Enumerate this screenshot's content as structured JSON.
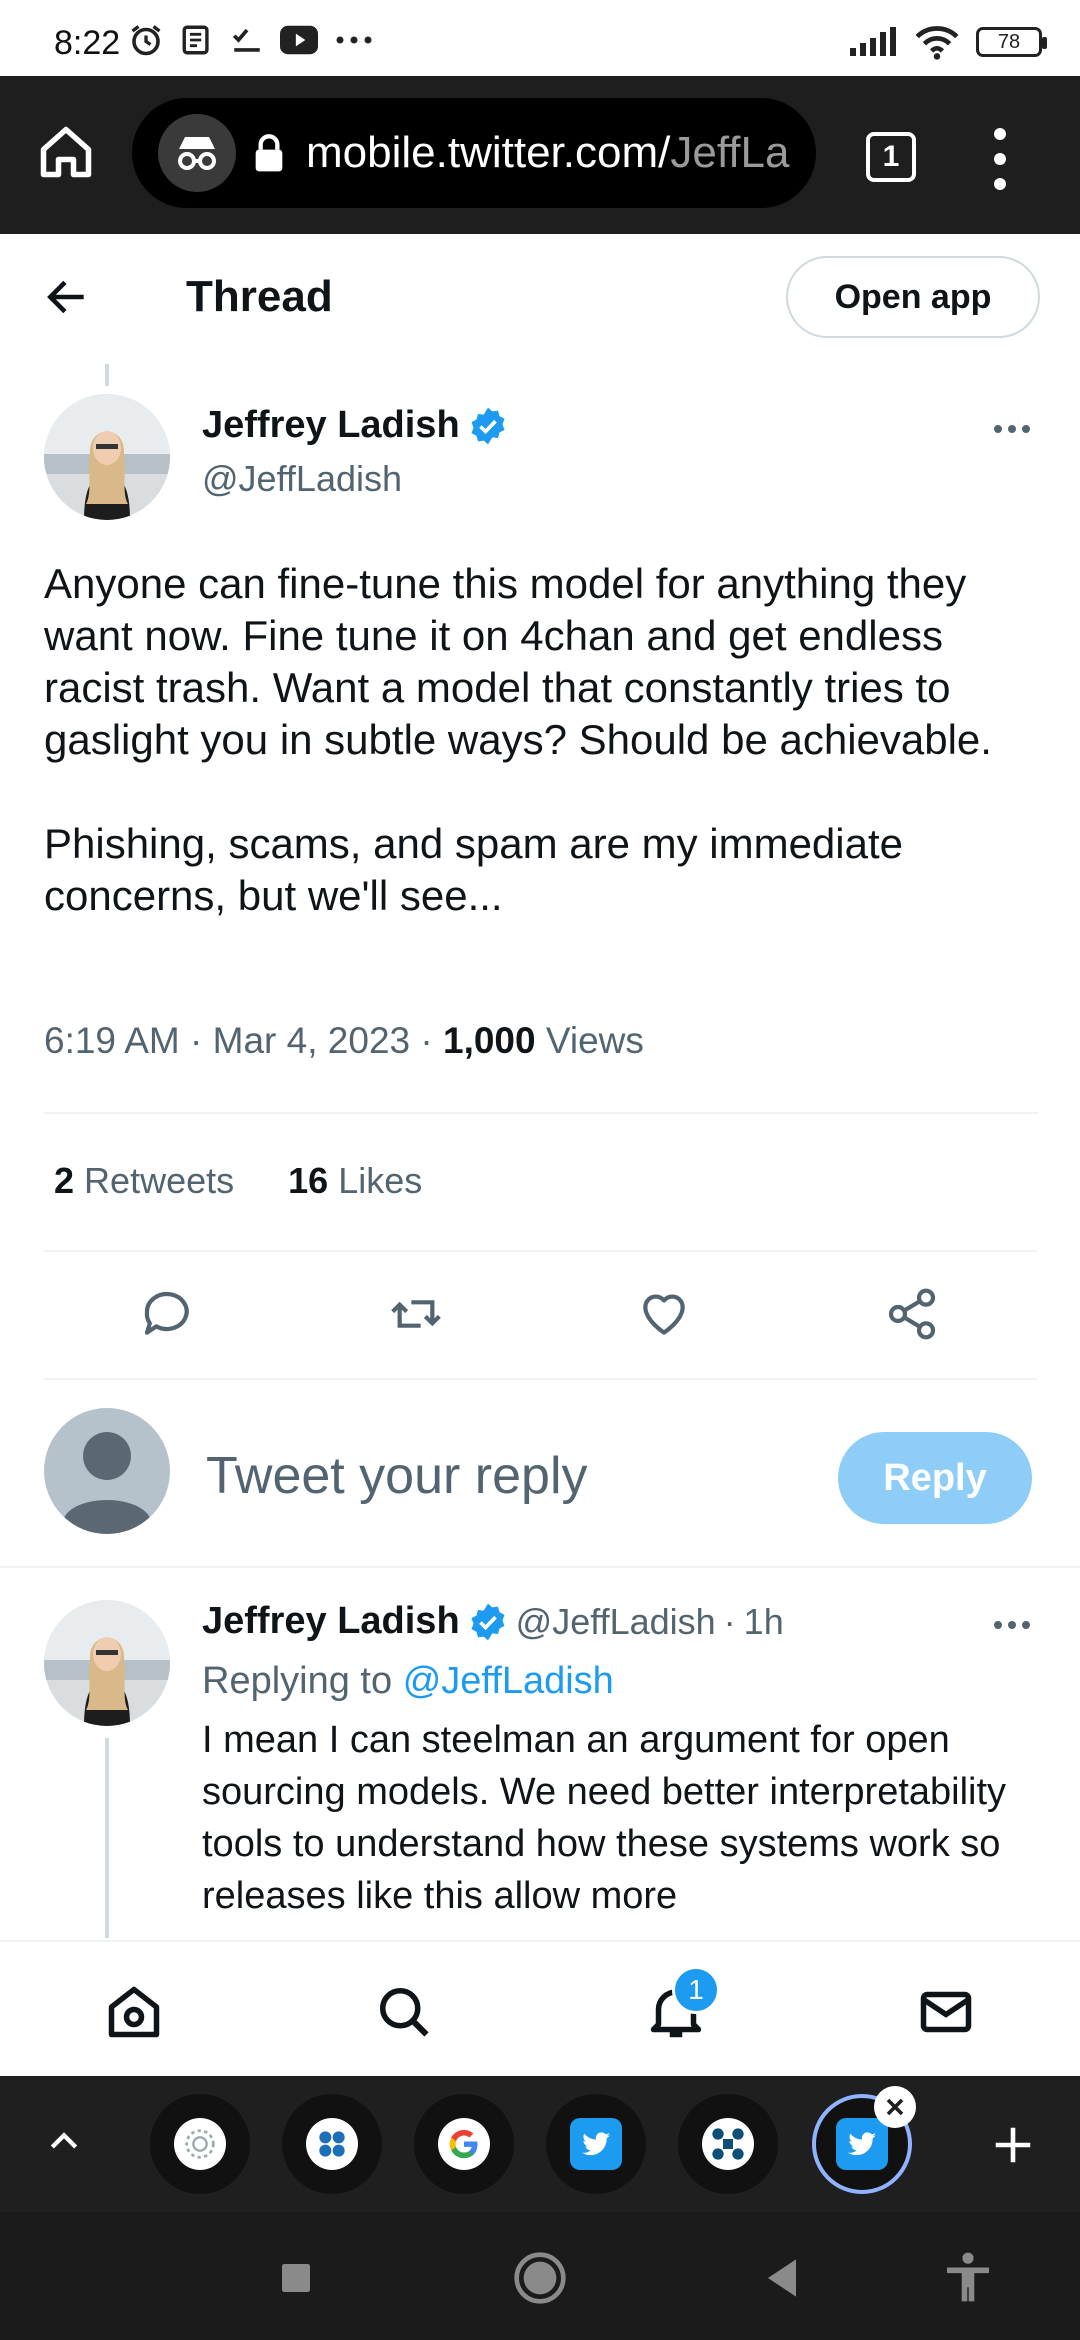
{
  "status_bar": {
    "time": "8:22",
    "battery": "78"
  },
  "browser": {
    "url_host": "mobile.twitter.com/",
    "url_path": "JeffLa",
    "tab_count": "1"
  },
  "header": {
    "title": "Thread",
    "open_app_label": "Open app"
  },
  "main_tweet": {
    "author_name": "Jeffrey Ladish",
    "handle": "@JeffLadish",
    "text": "Anyone can fine-tune this model for anything they want now. Fine tune it on 4chan and get endless racist trash. Want a model that constantly tries to gaslight you in subtle ways? Should be achievable.\n\nPhishing, scams, and spam are my immediate concerns, but we'll see...",
    "time": "6:19 AM",
    "date": "Mar 4, 2023",
    "views_count": "1,000",
    "views_label": "Views",
    "retweets_count": "2",
    "retweets_label": "Retweets",
    "likes_count": "16",
    "likes_label": "Likes"
  },
  "composer": {
    "placeholder": "Tweet your reply",
    "reply_label": "Reply"
  },
  "reply_tweet": {
    "author_name": "Jeffrey Ladish",
    "handle": "@JeffLadish",
    "age": "1h",
    "replying_prefix": "Replying to",
    "replying_to": "@JeffLadish",
    "text": "I mean I can steelman an argument for open sourcing models. We need better interpretability tools to understand how these systems work so releases like this allow more"
  },
  "bottom_nav": {
    "notifications_badge": "1"
  },
  "colors": {
    "accent": "#1d9bf0",
    "reply_button_disabled": "#8ecdf8",
    "text_secondary": "#536471"
  }
}
